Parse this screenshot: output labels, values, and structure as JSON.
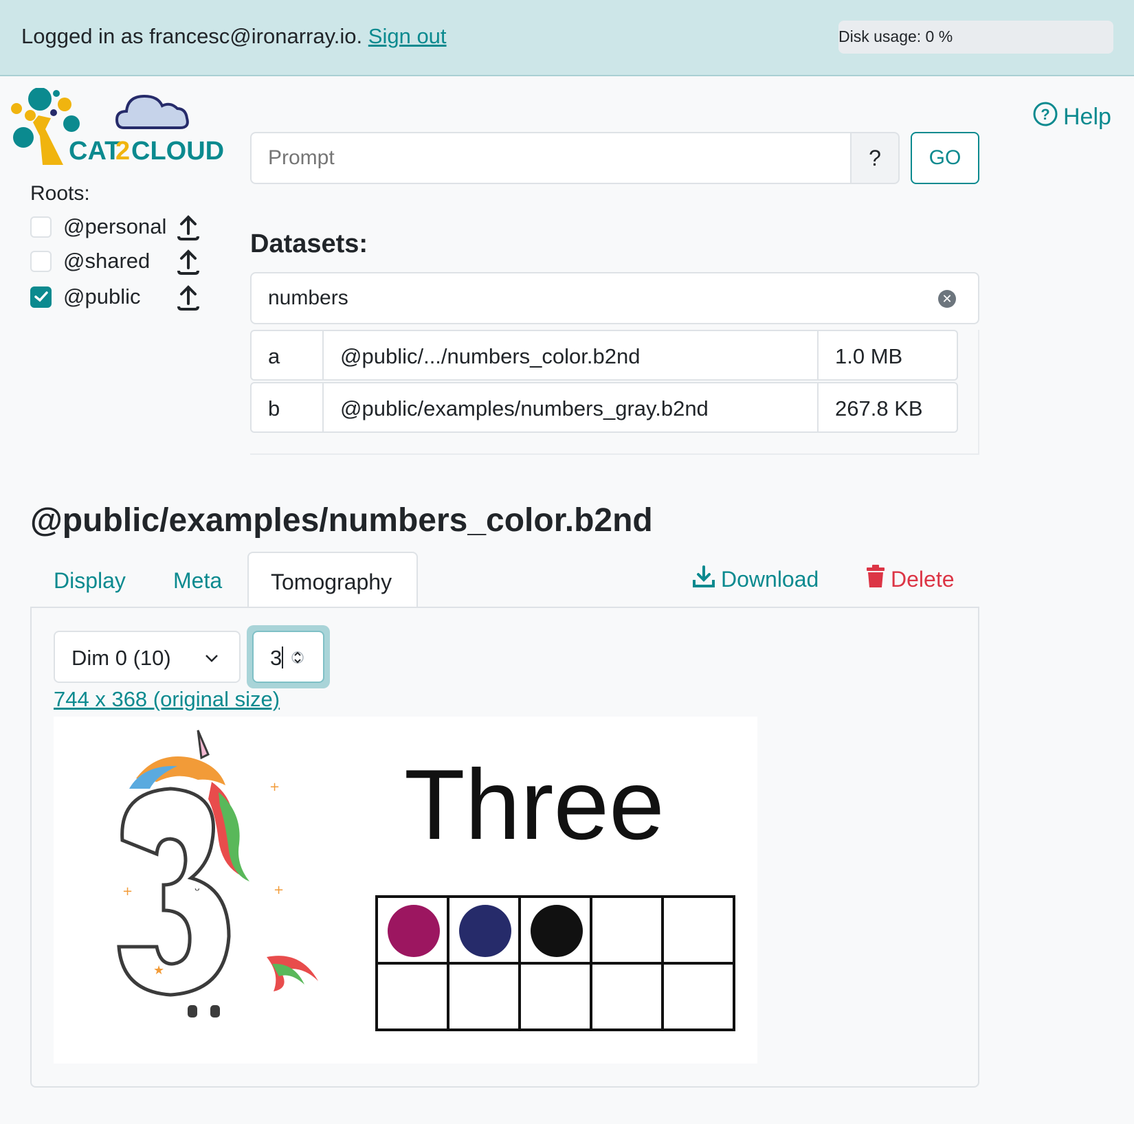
{
  "header": {
    "login_prefix": "Logged in as francesc@ironarray.io.",
    "signout_label": "Sign out",
    "disk_usage": "Disk usage: 0 %"
  },
  "logo": {
    "text_left": "CAT",
    "text_mid": "2",
    "text_right": "CLOUD"
  },
  "help_label": "Help",
  "roots": {
    "title": "Roots:",
    "items": [
      {
        "label": "@personal",
        "checked": false
      },
      {
        "label": "@shared",
        "checked": false
      },
      {
        "label": "@public",
        "checked": true
      }
    ]
  },
  "prompt": {
    "placeholder": "Prompt",
    "help_label": "?",
    "go_label": "GO"
  },
  "datasets": {
    "title": "Datasets:",
    "filter_value": "numbers",
    "rows": [
      {
        "id": "a",
        "path": "@public/.../numbers_color.b2nd",
        "size": "1.0 MB"
      },
      {
        "id": "b",
        "path": "@public/examples/numbers_gray.b2nd",
        "size": "267.8 KB"
      }
    ]
  },
  "selected": {
    "title": "@public/examples/numbers_color.b2nd",
    "tabs": [
      "Display",
      "Meta",
      "Tomography"
    ],
    "active_tab": "Tomography",
    "download_label": "Download",
    "delete_label": "Delete"
  },
  "tomography": {
    "dim_select": "Dim 0 (10)",
    "index_value": "3",
    "size_link": "744 x 368 (original size)"
  },
  "image": {
    "word": "Three",
    "digit": "3",
    "ten_frame_dots": [
      "#9c1660",
      "#262b6a",
      "#111111"
    ]
  },
  "colors": {
    "accent": "#0b8a8f",
    "danger": "#dc3545",
    "topbar": "#cde6e8"
  }
}
